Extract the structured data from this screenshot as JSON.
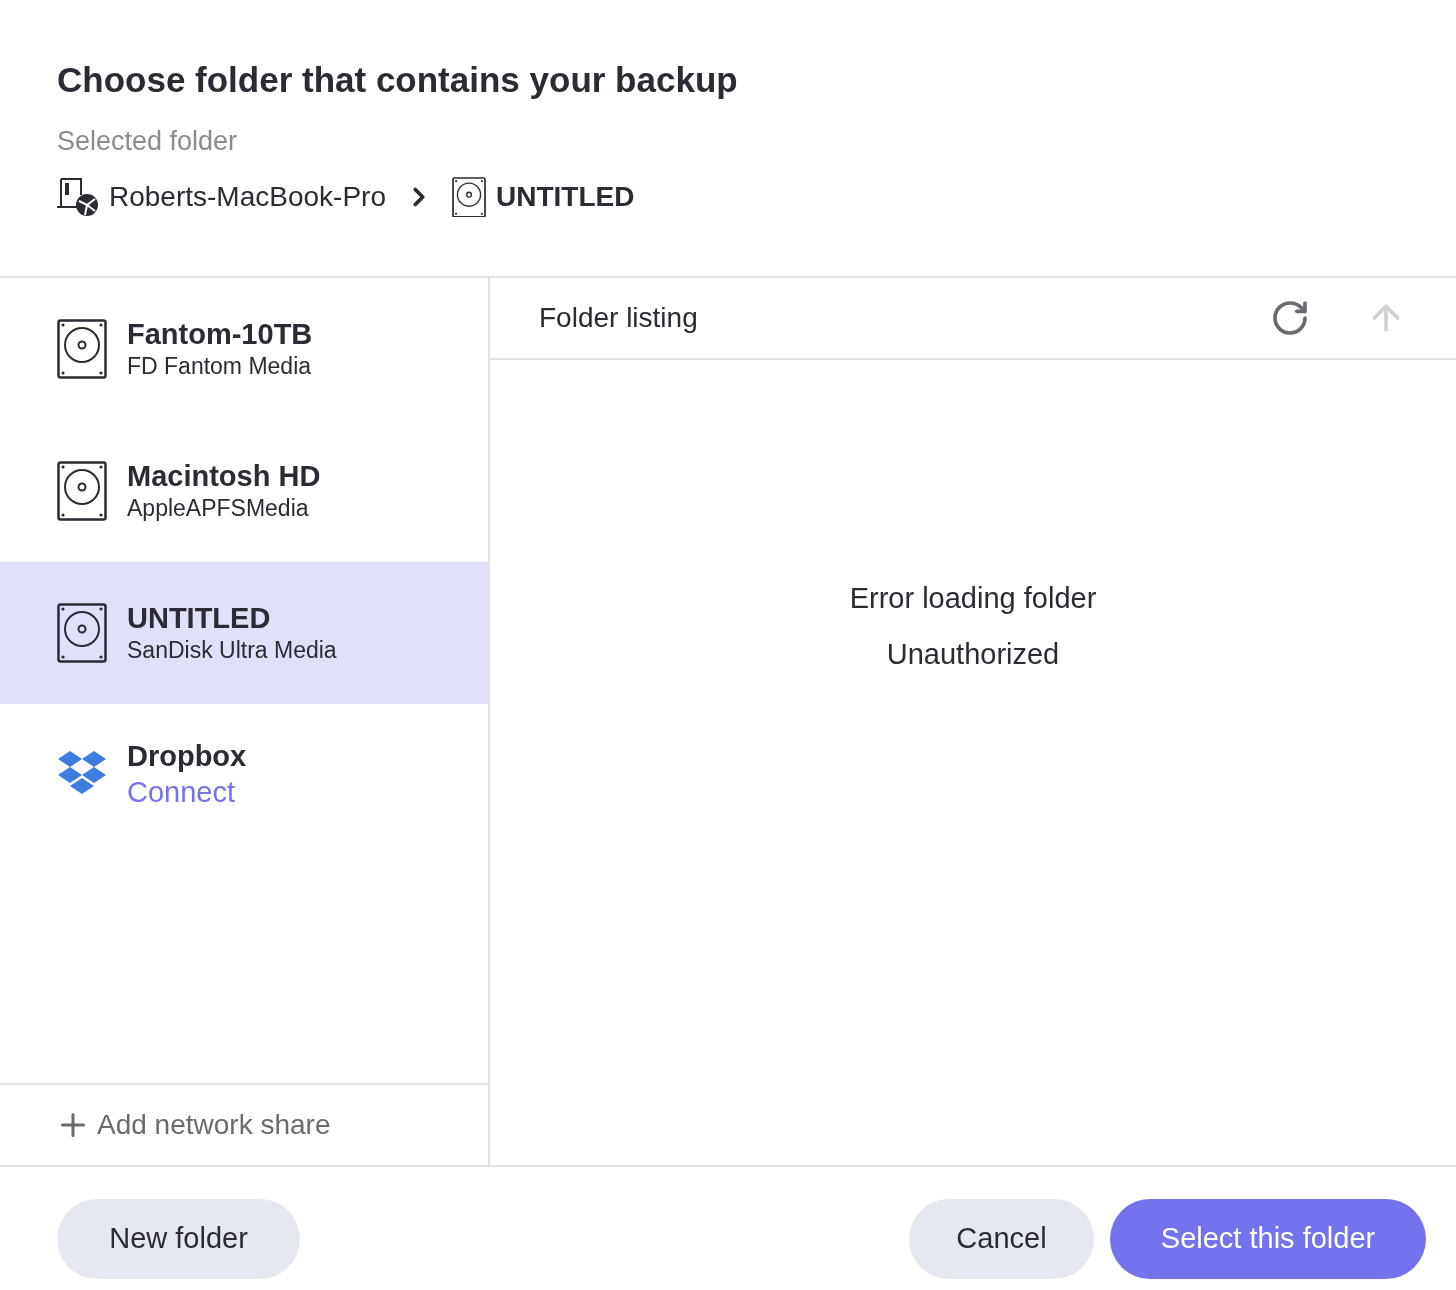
{
  "title": "Choose folder that contains your backup",
  "selected_folder": {
    "label": "Selected folder",
    "path": [
      {
        "kind": "computer",
        "label": "Roberts-MacBook-Pro"
      },
      {
        "kind": "drive",
        "label": "UNTITLED"
      }
    ]
  },
  "locations": [
    {
      "kind": "drive",
      "name": "Fantom-10TB",
      "subtitle": "FD Fantom Media",
      "selected": false
    },
    {
      "kind": "drive",
      "name": "Macintosh HD",
      "subtitle": "AppleAPFSMedia",
      "selected": false
    },
    {
      "kind": "drive",
      "name": "UNTITLED",
      "subtitle": "SanDisk Ultra Media",
      "selected": true
    },
    {
      "kind": "dropbox",
      "name": "Dropbox",
      "link": "Connect",
      "selected": false
    }
  ],
  "add_share": "Add network share",
  "listing": {
    "title": "Folder listing",
    "up_disabled": true,
    "messages": [
      "Error loading folder",
      "Unauthorized"
    ]
  },
  "buttons": {
    "new_folder": "New folder",
    "cancel": "Cancel",
    "confirm": "Select this folder"
  }
}
